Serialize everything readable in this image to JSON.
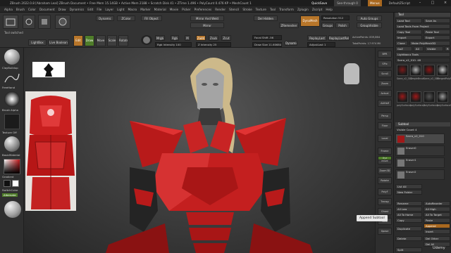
{
  "titlebar": {
    "text": "ZBrush 2022.0.8 [Abraham Leal]   ZBrush Document   •  Free Mem 15.14GB  •  Active Mem 2188  •  Scratch Disk 41  •  ZTime 1.496  •  PolyCount 0.476 KP  •  MeshCount 1",
    "quicksave": "QuickSave",
    "see_through": "See-through 0",
    "menus_label": "Menus",
    "script_label": "DefaultZScript"
  },
  "menubar": {
    "items": [
      "Alpha",
      "Brush",
      "Color",
      "Document",
      "Draw",
      "Dynamics",
      "Edit",
      "File",
      "Layer",
      "Light",
      "Macro",
      "Marker",
      "Material",
      "Movie",
      "Picker",
      "Preferences",
      "Render",
      "Stencil",
      "Stroke",
      "Texture",
      "Tool",
      "Transform",
      "Zplugin",
      "Zscript",
      "Help"
    ]
  },
  "toolbar": {
    "tool_switched": "Tool switched",
    "lightbox": "LightBox",
    "live_boolean": "Live Boolean",
    "edit": "Edit",
    "draw": "Draw",
    "move": "Move",
    "scale": "Scale",
    "rotate": "Rotate",
    "mrgb": "Mrgb",
    "rgb": "Rgb",
    "m": "M",
    "zadd": "Zadd",
    "zsub": "Zsub",
    "zcut": "Zcut",
    "rgb_intensity": "Rgb Intensity 100",
    "z_intensity": "Z Intensity 25",
    "focal_shift": "Focal Shift -56",
    "draw_size": "Draw Size 11.60684",
    "dynamic": "Dynamic",
    "mirror_and_weld": "Mirror And Weld",
    "del_hidden": "Del Hidden",
    "mirror": "Mirror",
    "zremesher": "ZRemesher",
    "dynamesh": "DynaMesh",
    "resolution": "Resolution 512",
    "groups": "Groups",
    "polish": "Polish",
    "auto_groups": "Auto Groups",
    "group_visible": "GroupVisible",
    "replay_last": "ReplayLast",
    "replay_last_rel": "ReplayLastRel",
    "adjust_last": "AdjustLast 1",
    "active_points": "ActivePoints: 839,864",
    "total_points": "TotalPoints: 17.974 Mil",
    "persp": "Persp",
    "floor": "Floor",
    "divide": "Divide",
    "smt": "Smt",
    "suv": "Suv",
    "rgb2": "RGB",
    "zcolor": "ZColor",
    "thick": "Thick 0",
    "fill": "Fill Object"
  },
  "lefttray": {
    "brush": "ClayBuildup",
    "stroke": "FreeHand",
    "alpha": "Brush Alpha",
    "texture": "Texture Off",
    "material": "BasicMaterial",
    "gradient": "Gradient",
    "switch_color": "SwitchColor",
    "alternate": "Alternate"
  },
  "toolpanel": {
    "title": "Tool",
    "load_tool": "Load Tool",
    "save_as": "Save As",
    "load_tools_from_project": "Load Tools From Project",
    "copy_tool": "Copy Tool",
    "paste_tool": "Paste Tool",
    "import": "Import",
    "export": "Export",
    "clone": "Clone",
    "make_polymesh": "Make PolyMesh3D",
    "goz": "GoZ",
    "all": "All",
    "visible": "Visible",
    "r": "R",
    "lightbox_tools": "Lightbox ▸ Tools",
    "current_tool": "Sarra_v2_010. 48",
    "thumbs": [
      {
        "label": "Sarra_v2_010"
      },
      {
        "label": "SimpleBrush"
      },
      {
        "label": "Sarra_v2_010"
      },
      {
        "label": "MergedPolySurf"
      },
      {
        "label": "polySurface1"
      },
      {
        "label": "polySurface7"
      },
      {
        "label": "polySurface2"
      },
      {
        "label": "polySurface9"
      }
    ],
    "subtool": "Subtool",
    "visible_count": "Visible Count 4",
    "subtools": [
      {
        "label": "Sarra_v2_010"
      },
      {
        "label": "Eraser0"
      },
      {
        "label": "Eraser1"
      },
      {
        "label": "Eraser2"
      }
    ],
    "list_all": "List All",
    "new_folder": "New Folder",
    "rename": "Rename",
    "auto_reorder": "AutoReorder",
    "all_low": "All Low",
    "all_high": "All High",
    "all_to_home": "All To Home",
    "all_to_target": "All To Target",
    "copy": "Copy",
    "paste": "Paste",
    "duplicate": "Duplicate",
    "append": "Append",
    "insert": "Insert",
    "delete": "Delete",
    "del_other": "Del Other",
    "del_all": "Del All",
    "split": "Split"
  },
  "tooltip": "Append Subtool",
  "watermark": "Udemy",
  "colors": {
    "accent_orange": "#b8762a",
    "accent_green": "#4f7d2a",
    "armor_red": "#c21d1d"
  }
}
